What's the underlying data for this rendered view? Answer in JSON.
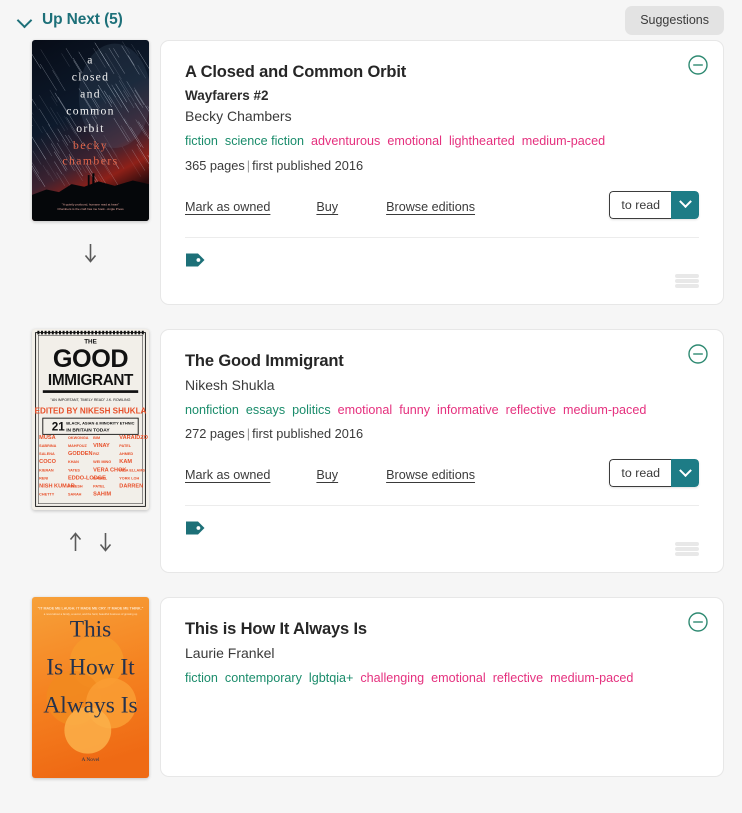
{
  "header": {
    "title": "Up Next (5)",
    "collapse_icon": "chevron-down-icon",
    "suggestions_label": "Suggestions"
  },
  "labels": {
    "mark_as_owned": "Mark as owned",
    "buy": "Buy",
    "browse_editions": "Browse editions",
    "shelf_status": "to read",
    "remove_icon": "minus-circle-icon",
    "tag_icon": "tag-icon",
    "drag_icon": "drag-handle-icon",
    "move_up_icon": "arrow-up-icon",
    "move_down_icon": "arrow-down-icon",
    "caret_icon": "chevron-down-icon"
  },
  "colors": {
    "accent_teal": "#1d7c86",
    "genre_tag": "#1a8c6b",
    "mood_tag": "#e5307e",
    "page_background": "#f6f6f6",
    "card_background": "#ffffff",
    "card_border": "#e7e7e7",
    "suggestions_button": "#e3e3e3"
  },
  "books": [
    {
      "title": "A Closed and Common Orbit",
      "series": "Wayfarers #2",
      "author": "Becky Chambers",
      "genre_tags": [
        "fiction",
        "science fiction"
      ],
      "mood_tags": [
        "adventurous",
        "emotional",
        "lighthearted",
        "medium-paced"
      ],
      "pages": "365 pages",
      "published": "first published 2016",
      "cover": {
        "alt": "A Closed and Common Orbit cover",
        "style": "starfield",
        "lines": [
          "a",
          "closed",
          "and",
          "common",
          "orbit"
        ],
        "author_lines": [
          "becky",
          "chambers"
        ]
      },
      "can_move_up": false,
      "can_move_down": true
    },
    {
      "title": "The Good Immigrant",
      "series": null,
      "author": "Nikesh Shukla",
      "genre_tags": [
        "nonfiction",
        "essays",
        "politics"
      ],
      "mood_tags": [
        "emotional",
        "funny",
        "informative",
        "reflective",
        "medium-paced"
      ],
      "pages": "272 pages",
      "published": "first published 2016",
      "cover": {
        "alt": "The Good Immigrant cover",
        "style": "typographic",
        "top_word": "THE",
        "lines": [
          "GOOD",
          "IMMIGRANT"
        ],
        "editor_line": "EDITED BY NIKESH SHUKLA",
        "number": "21",
        "subtitle_lines": [
          "BLACK, ASIAN & MINORITY ETHNIC",
          "IN BRITAIN TODAY"
        ],
        "contributors": [
          "MUSA",
          "OKWONGA",
          "BIM",
          "VARAIDZO",
          "SABRINA",
          "MAHFOUZ",
          "VINAY",
          "PATEL",
          "SALENA",
          "GODDEN",
          "RIZ",
          "AHMED",
          "COCO",
          "KHAN",
          "WEI MING",
          "KAM",
          "KIERAN",
          "YATES",
          "VERA CHOK",
          "INUA ELLAMS",
          "RENI",
          "EDDO-LODGE",
          "DANIEL",
          "YORK LOH",
          "NISH KUMAR",
          "HIMESH",
          "PATEL",
          "DARREN",
          "CHETTY",
          "SARAH",
          "SAHIM"
        ]
      },
      "can_move_up": true,
      "can_move_down": true
    },
    {
      "title": "This is How It Always Is",
      "series": null,
      "author": "Laurie Frankel",
      "genre_tags": [
        "fiction",
        "contemporary",
        "lgbtqia+"
      ],
      "mood_tags": [
        "challenging",
        "emotional",
        "reflective",
        "medium-paced"
      ],
      "pages": null,
      "published": null,
      "cover": {
        "alt": "This is How It Always Is cover",
        "style": "oranges",
        "lines": [
          "This",
          "Is How It",
          "Always Is"
        ]
      },
      "can_move_up": true,
      "can_move_down": false
    }
  ]
}
